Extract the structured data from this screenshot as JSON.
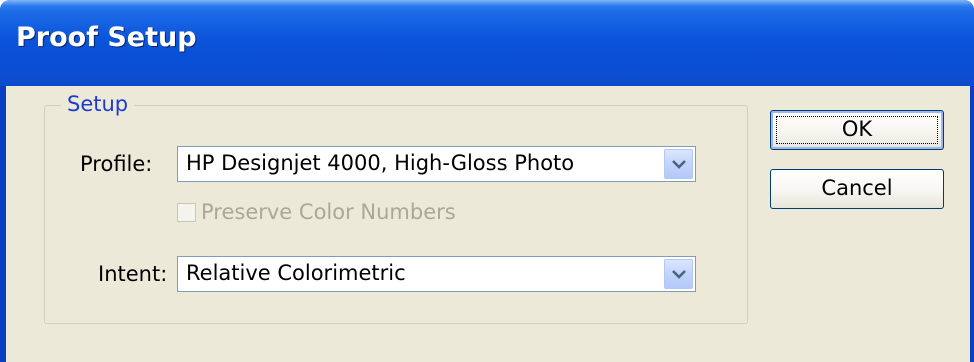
{
  "dialog": {
    "title": "Proof Setup"
  },
  "setup_group": {
    "label": "Setup",
    "profile": {
      "label": "Profile:",
      "value": "HP Designjet 4000, High-Gloss Photo"
    },
    "preserve_color_numbers": {
      "label": "Preserve Color Numbers",
      "checked": false,
      "enabled": false
    },
    "intent": {
      "label": "Intent:",
      "value": "Relative Colorimetric"
    }
  },
  "buttons": {
    "ok_label": "OK",
    "cancel_label": "Cancel"
  },
  "icons": {
    "dropdown": "chevron-down-icon",
    "checkbox": "checkbox-icon"
  },
  "colors": {
    "titlebar": "#0a54da",
    "dialog_background": "#ece9d8",
    "group_label": "#1c3ccf",
    "disabled_text": "#aca899"
  }
}
